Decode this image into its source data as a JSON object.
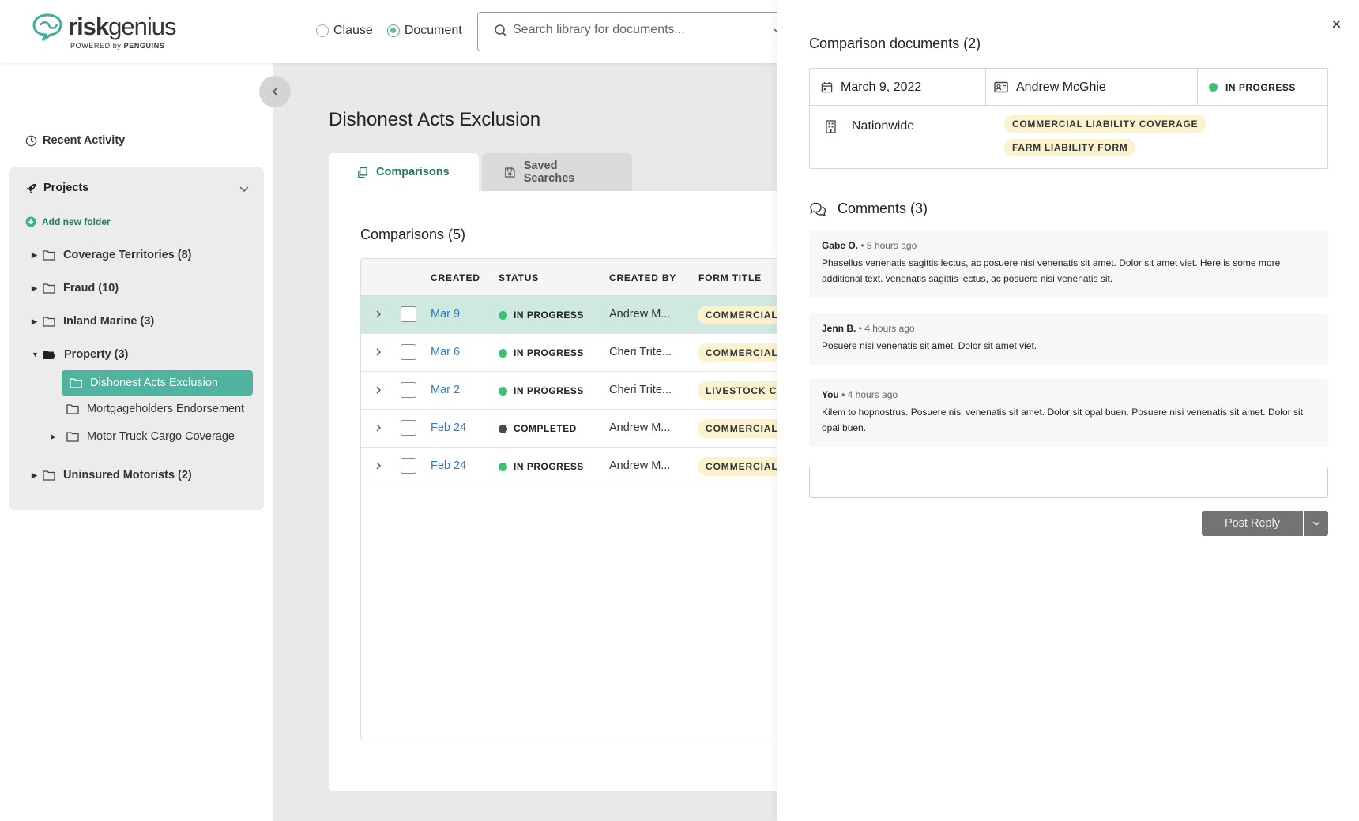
{
  "header": {
    "logo_word_light": "risk",
    "logo_word_rest": "genius",
    "logo_powered": "POWERED by",
    "logo_brand": "PENGUINS",
    "radio_clause": "Clause",
    "radio_document": "Document",
    "search_placeholder": "Search library for documents..."
  },
  "sidebar": {
    "recent_activity": "Recent Activity",
    "projects_label": "Projects",
    "add_folder": "Add new folder",
    "folders": [
      "Coverage Territories (8)",
      "Fraud (10)",
      "Inland Marine (3)",
      "Property (3)",
      "Dishonest Acts Exclusion",
      "Mortgageholders Endorsement",
      "Motor Truck Cargo Coverage",
      "Uninsured Motorists (2)"
    ]
  },
  "main": {
    "title": "Dishonest Acts Exclusion",
    "tabs": [
      "Comparisons",
      "Saved Searches"
    ],
    "comparisons_title": "Comparisons (5)",
    "columns": [
      "CREATED",
      "STATUS",
      "CREATED BY",
      "FORM TITLE"
    ],
    "rows": [
      {
        "created": "Mar 9",
        "status": "IN PROGRESS",
        "by": "Andrew M...",
        "form": "COMMERCIAL"
      },
      {
        "created": "Mar 6",
        "status": "IN PROGRESS",
        "by": "Cheri Trite...",
        "form": "COMMERCIAL"
      },
      {
        "created": "Mar 2",
        "status": "IN PROGRESS",
        "by": "Cheri Trite...",
        "form": "LIVESTOCK CO"
      },
      {
        "created": "Feb 24",
        "status": "COMPLETED",
        "by": "Andrew M...",
        "form": "COMMERCIAL"
      },
      {
        "created": "Feb 24",
        "status": "IN PROGRESS",
        "by": "Andrew M...",
        "form": "COMMERCIAL"
      }
    ]
  },
  "panel": {
    "title": "Comparison documents (2)",
    "date": "March 9, 2022",
    "author": "Andrew McGhie",
    "status": "IN PROGRESS",
    "carrier": "Nationwide",
    "tags": [
      "COMMERCIAL LIABILITY COVERAGE",
      "FARM LIABILITY FORM"
    ],
    "comments_title": "Comments (3)",
    "comments": [
      {
        "author": "Gabe O.",
        "time": "• 5 hours ago",
        "body": "Phasellus venenatis sagittis lectus, ac posuere nisi venenatis sit amet. Dolor sit amet viet. Here is some more additional text. venenatis sagittis lectus, ac posuere nisi venenatis sit."
      },
      {
        "author": "Jenn B.",
        "time": "• 4 hours ago",
        "body": "Posuere nisi venenatis sit amet. Dolor sit amet viet."
      },
      {
        "author": "You",
        "time": "• 4 hours ago",
        "body": "Kilem to hopnostrus. Posuere nisi venenatis sit amet. Dolor sit opal buen. Posuere nisi venenatis sit amet. Dolor sit opal buen."
      }
    ],
    "post_reply": "Post Reply",
    "close": "×"
  },
  "colors": {
    "accent": "#1e7d64",
    "active_folder": "#4fb3a0",
    "status_in_progress": "#3fbf72",
    "status_completed": "#444a52",
    "badge_bg": "#fbf3cd",
    "link": "#2e7bc4"
  }
}
